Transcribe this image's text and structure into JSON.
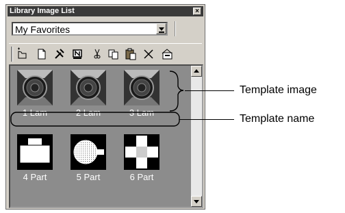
{
  "window": {
    "title": "Library Image List",
    "close_glyph": "×"
  },
  "combo": {
    "value": "My Favorites"
  },
  "toolbar": {
    "buttons": [
      {
        "icon": "new-folder-icon"
      },
      {
        "icon": "new-document-icon"
      },
      {
        "icon": "tools-icon"
      },
      {
        "icon": "name-icon"
      },
      {
        "icon": "cut-icon"
      },
      {
        "icon": "copy-icon"
      },
      {
        "icon": "paste-icon"
      },
      {
        "icon": "delete-icon"
      },
      {
        "icon": "properties-icon"
      }
    ]
  },
  "items": [
    {
      "caption": "1 Lam",
      "kind": "lamp"
    },
    {
      "caption": "2 Lam",
      "kind": "lamp"
    },
    {
      "caption": "3 Lam",
      "kind": "lamp"
    },
    {
      "caption": "4 Part",
      "kind": "part-box"
    },
    {
      "caption": "5 Part",
      "kind": "part-circle"
    },
    {
      "caption": "6 Part",
      "kind": "part-cross"
    }
  ],
  "annotations": {
    "template_image": "Template image",
    "template_name": "Template name"
  },
  "colors": {
    "list_bg": "#8c8c8c",
    "panel_bg": "#d4d0c8",
    "title_bg": "#3a3a3a"
  }
}
